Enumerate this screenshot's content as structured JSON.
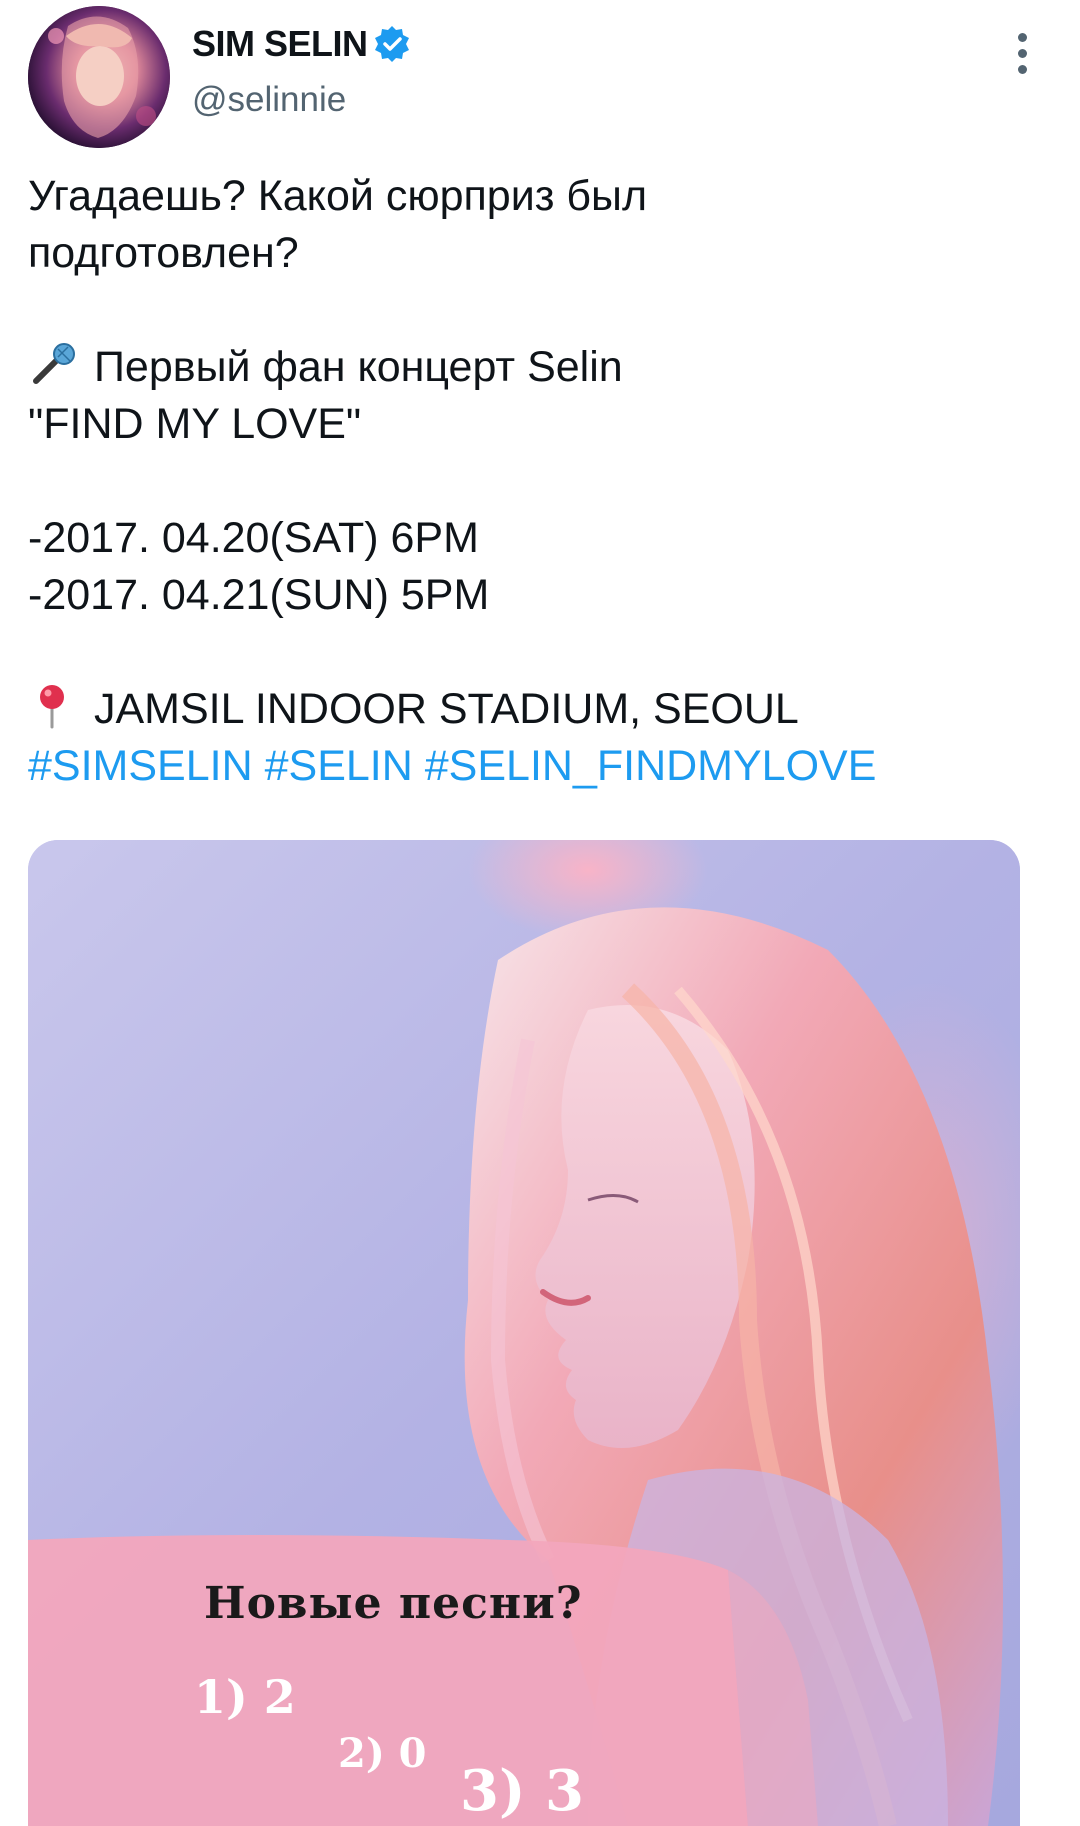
{
  "author": {
    "display_name": "SIM SELIN",
    "handle": "@selinnie",
    "verified": true,
    "avatar_icon": "profile-photo"
  },
  "menu": {
    "more_icon": "vertical-ellipsis-icon"
  },
  "tweet": {
    "line1": "Угадаешь? Какой сюрприз был",
    "line2": "подготовлен?",
    "concert_emoji": "microphone-emoji",
    "concert_line": "Первый фан концерт Selin",
    "concert_title": "\"FIND MY LOVE\"",
    "date1": "-2017. 04.20(SAT) 6PM",
    "date2": "-2017. 04.21(SUN) 5PM",
    "location_emoji": "round-pushpin-emoji",
    "location": "JAMSIL INDOOR STADIUM, SEOUL",
    "hashtags": [
      "#SIMSELIN",
      "#SELIN",
      "#SELIN_FINDMYLOVE"
    ],
    "link_color": "#1d9bf0"
  },
  "media": {
    "title": "Новые песни?",
    "options": [
      "1) 2",
      "2) 0",
      "3) 3"
    ],
    "banner_color": "#f2a7bd"
  },
  "colors": {
    "text": "#0f1419",
    "secondary": "#536471",
    "verified": "#1d9bf0"
  }
}
